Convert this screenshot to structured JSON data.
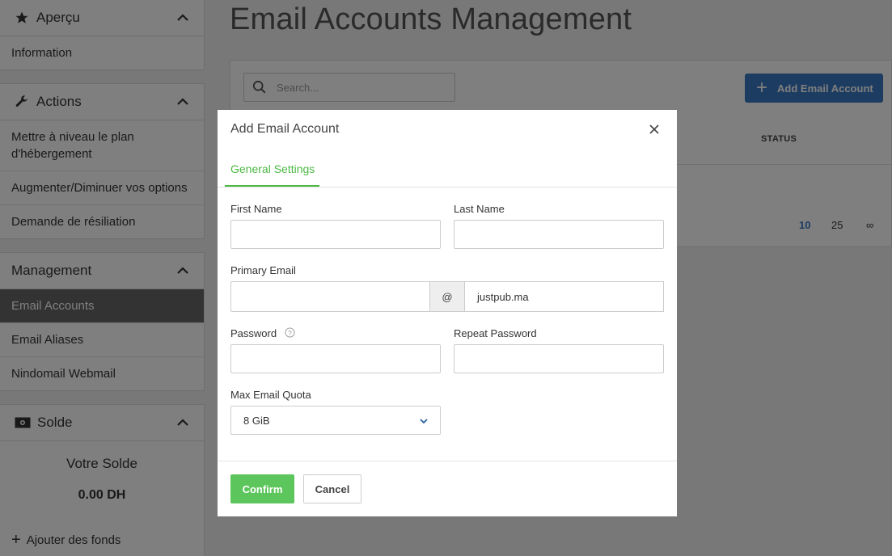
{
  "sidebar": {
    "overview": {
      "title": "Aperçu",
      "items": [
        "Information"
      ]
    },
    "actions": {
      "title": "Actions",
      "items": [
        "Mettre à niveau le plan d'hébergement",
        "Augmenter/Diminuer vos options",
        "Demande de résiliation"
      ]
    },
    "management": {
      "title": "Management",
      "items": [
        "Email Accounts",
        "Email Aliases",
        "Nindomail Webmail"
      ],
      "active": "Email Accounts"
    },
    "balance": {
      "title": "Solde",
      "label": "Votre Solde",
      "value": "0.00 DH",
      "add_funds": "Ajouter des fonds"
    }
  },
  "main": {
    "title": "Email Accounts Management",
    "search_placeholder": "Search...",
    "add_button": "Add Email Account",
    "status_header": "STATUS",
    "page_sizes": [
      "10",
      "25",
      "∞"
    ]
  },
  "modal": {
    "title": "Add Email Account",
    "tab": "General Settings",
    "first_name_label": "First Name",
    "last_name_label": "Last Name",
    "primary_email_label": "Primary Email",
    "at_symbol": "@",
    "domain": "justpub.ma",
    "password_label": "Password",
    "repeat_password_label": "Repeat Password",
    "quota_label": "Max Email Quota",
    "quota_value": "8 GiB",
    "confirm": "Confirm",
    "cancel": "Cancel"
  },
  "colors": {
    "accent_green": "#5cc55c",
    "tab_green": "#4cb843",
    "primary_blue": "#3b79c3"
  }
}
